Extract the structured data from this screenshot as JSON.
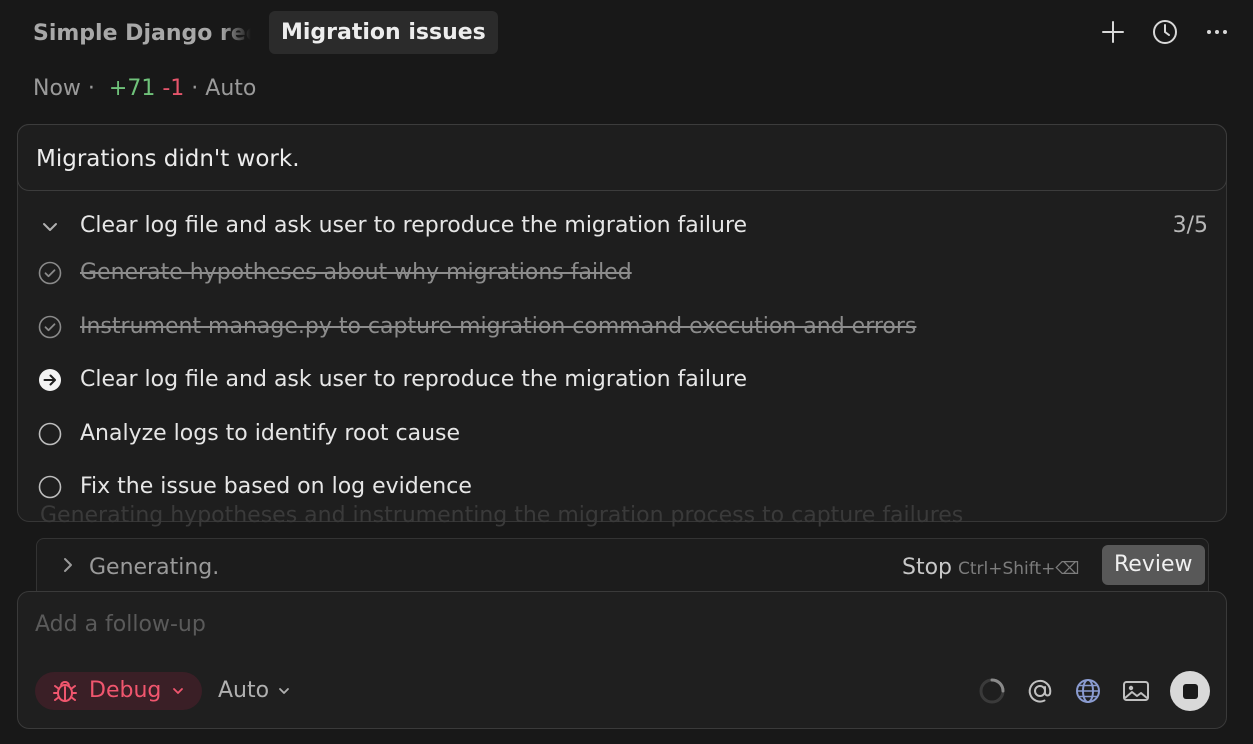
{
  "tabs": {
    "inactive_label": "Simple Django recipe",
    "active_label": "Migration issues"
  },
  "tab_actions": {
    "new_icon": "plus-icon",
    "history_icon": "clock-icon",
    "more_icon": "ellipsis-icon"
  },
  "meta": {
    "time": "Now",
    "sep1": "·",
    "added": "+71",
    "removed": "-1",
    "sep2": "·",
    "mode": "Auto"
  },
  "prompt": {
    "text": "Migrations didn't work."
  },
  "todos": {
    "header": "Clear log file and ask user to reproduce the migration failure",
    "count": "3/5",
    "items": [
      {
        "label": "Generate hypotheses about why migrations failed",
        "status": "done"
      },
      {
        "label": "Instrument manage.py to capture migration command execution and errors",
        "status": "done"
      },
      {
        "label": "Clear log file and ask user to reproduce the migration failure",
        "status": "in-progress"
      },
      {
        "label": "Analyze logs to identify root cause",
        "status": "pending"
      },
      {
        "label": "Fix the issue based on log evidence",
        "status": "pending"
      }
    ]
  },
  "background_text": "Generating hypotheses and instrumenting the migration process to capture failures",
  "generation": {
    "status": "Generating.",
    "stop_label": "Stop",
    "stop_shortcut": "Ctrl+Shift+⌫",
    "review_label": "Review"
  },
  "composer": {
    "placeholder": "Add a follow-up",
    "value": "",
    "mode_label": "Debug",
    "mode_icon": "bug-icon",
    "model_label": "Auto"
  },
  "colors": {
    "background": "#181818",
    "added": "#6fc27a",
    "removed": "#e5556b",
    "debug_accent": "#f0566e",
    "debug_bg": "#3a1f26",
    "review_bg": "#585858"
  }
}
